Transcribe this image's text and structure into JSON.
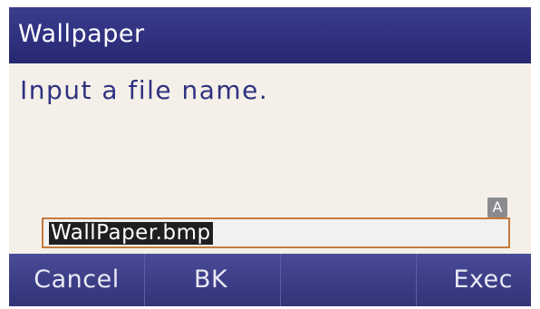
{
  "title_bar": {
    "title": "Wallpaper"
  },
  "content": {
    "prompt": "Input a file name.",
    "input_mode_badge": "A",
    "file_name_value": "WallPaper.bmp"
  },
  "softkeys": {
    "cancel": "Cancel",
    "bk": "BK",
    "empty": "",
    "exec": "Exec"
  },
  "colors": {
    "title_bar": "#2f3180",
    "screen_background": "#f4f0e9",
    "prompt_text": "#2f3180",
    "input_border": "#c87a3a",
    "softkey_bar": "#3c3e88"
  }
}
